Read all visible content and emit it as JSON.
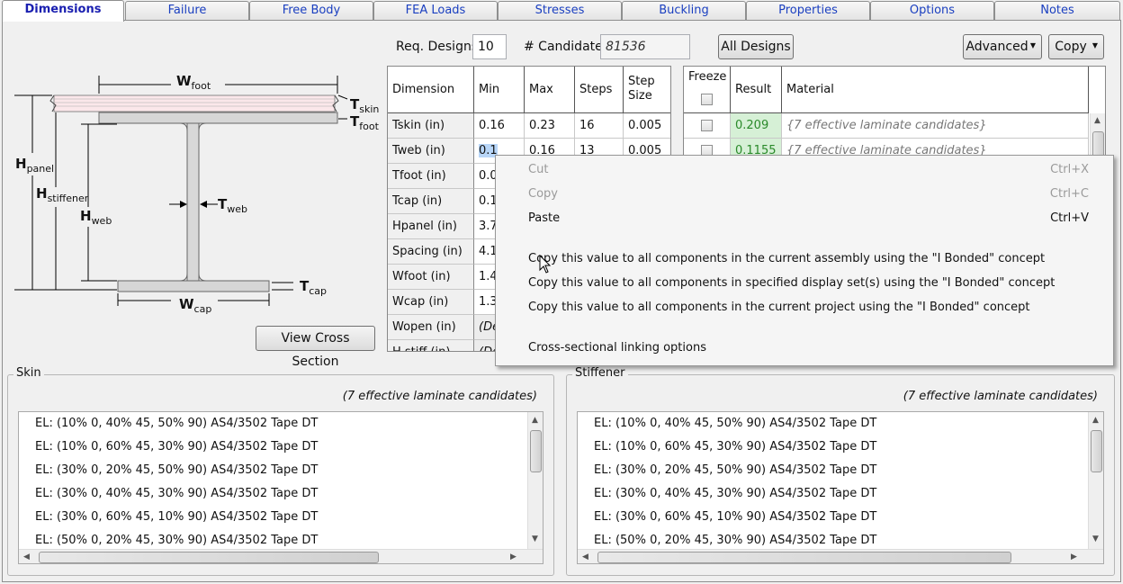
{
  "tabs": [
    {
      "label": "Dimensions",
      "active": true
    },
    {
      "label": "Failure"
    },
    {
      "label": "Free Body"
    },
    {
      "label": "FEA Loads"
    },
    {
      "label": "Stresses"
    },
    {
      "label": "Buckling"
    },
    {
      "label": "Properties"
    },
    {
      "label": "Options"
    },
    {
      "label": "Notes"
    }
  ],
  "toolbar": {
    "req_designs_label": "Req. Designs",
    "req_designs_value": "10",
    "candidates_label": "# Candidates",
    "candidates_value": "81536",
    "all_designs_label": "All Designs",
    "advanced_label": "Advanced",
    "copy_label": "Copy"
  },
  "diagram": {
    "labels": {
      "w_foot": "W",
      "w_foot_sub": "foot",
      "t_skin": "T",
      "t_skin_sub": "skin",
      "t_foot": "T",
      "t_foot_sub": "foot",
      "h_panel": "H",
      "h_panel_sub": "panel",
      "h_stiffener": "H",
      "h_stiffener_sub": "stiffener",
      "h_web": "H",
      "h_web_sub": "web",
      "t_web": "T",
      "t_web_sub": "web",
      "t_cap": "T",
      "t_cap_sub": "cap",
      "w_cap": "W",
      "w_cap_sub": "cap"
    },
    "view_cross_section_label": "View Cross Section"
  },
  "dimension_grid": {
    "headers": [
      "Dimension",
      "Min",
      "Max",
      "Steps",
      "Step Size"
    ],
    "rows": [
      [
        "Tskin (in)",
        "0.16",
        "0.23",
        "16",
        "0.005"
      ],
      [
        "Tweb (in)",
        "0.1",
        "0.16",
        "13",
        "0.005"
      ],
      [
        "Tfoot (in)",
        "0.0",
        "",
        "",
        ""
      ],
      [
        "Tcap (in)",
        "0.1",
        "",
        "",
        ""
      ],
      [
        "Hpanel (in)",
        "3.7",
        "",
        "",
        ""
      ],
      [
        "Spacing (in)",
        "4.1",
        "",
        "",
        ""
      ],
      [
        "Wfoot (in)",
        "1.4",
        "",
        "",
        ""
      ],
      [
        "Wcap (in)",
        "1.3",
        "",
        "",
        ""
      ],
      [
        "Wopen (in)",
        "(De",
        "",
        "",
        ""
      ],
      [
        "H stiff (in)",
        "(De",
        "",
        "",
        ""
      ]
    ]
  },
  "material_grid": {
    "headers": [
      "Freeze",
      "Result",
      "Material"
    ],
    "rows": [
      {
        "result": "0.209",
        "material": "{7 effective laminate candidates}"
      },
      {
        "result": "0.1155",
        "material": "{7 effective laminate candidates}"
      }
    ]
  },
  "context_menu": {
    "items": [
      {
        "label": "Cut",
        "shortcut": "Ctrl+X",
        "disabled": true
      },
      {
        "label": "Copy",
        "shortcut": "Ctrl+C",
        "disabled": true
      },
      {
        "label": "Paste",
        "shortcut": "Ctrl+V",
        "disabled": false
      },
      {
        "label": "Copy this value to all components in the current assembly using the \"I Bonded\" concept"
      },
      {
        "label": "Copy this value to all components in specified display set(s) using the \"I Bonded\" concept"
      },
      {
        "label": "Copy this value to all components in the current project using the \"I Bonded\" concept"
      },
      {
        "label": "Cross-sectional linking options"
      }
    ]
  },
  "skin": {
    "title": "Skin",
    "summary": "(7 effective laminate candidates)",
    "items": [
      "EL: (10% 0, 40% 45, 50% 90) AS4/3502 Tape DT",
      "EL: (10% 0, 60% 45, 30% 90) AS4/3502 Tape DT",
      "EL: (30% 0, 20% 45, 50% 90) AS4/3502 Tape DT",
      "EL: (30% 0, 40% 45, 30% 90) AS4/3502 Tape DT",
      "EL: (30% 0, 60% 45, 10% 90) AS4/3502 Tape DT",
      "EL: (50% 0, 20% 45, 30% 90) AS4/3502 Tape DT"
    ]
  },
  "stiffener": {
    "title": "Stiffener",
    "summary": "(7 effective laminate candidates)",
    "items": [
      "EL: (10% 0, 40% 45, 50% 90) AS4/3502 Tape DT",
      "EL: (10% 0, 60% 45, 30% 90) AS4/3502 Tape DT",
      "EL: (30% 0, 20% 45, 50% 90) AS4/3502 Tape DT",
      "EL: (30% 0, 40% 45, 30% 90) AS4/3502 Tape DT",
      "EL: (30% 0, 60% 45, 10% 90) AS4/3502 Tape DT",
      "EL: (50% 0, 20% 45, 30% 90) AS4/3502 Tape DT"
    ]
  },
  "colors": {
    "tab_text": "#1a3fc0",
    "result_bg": "#d6f0d6",
    "result_text": "#2a8a2a",
    "selection": "#b8d6f8"
  }
}
